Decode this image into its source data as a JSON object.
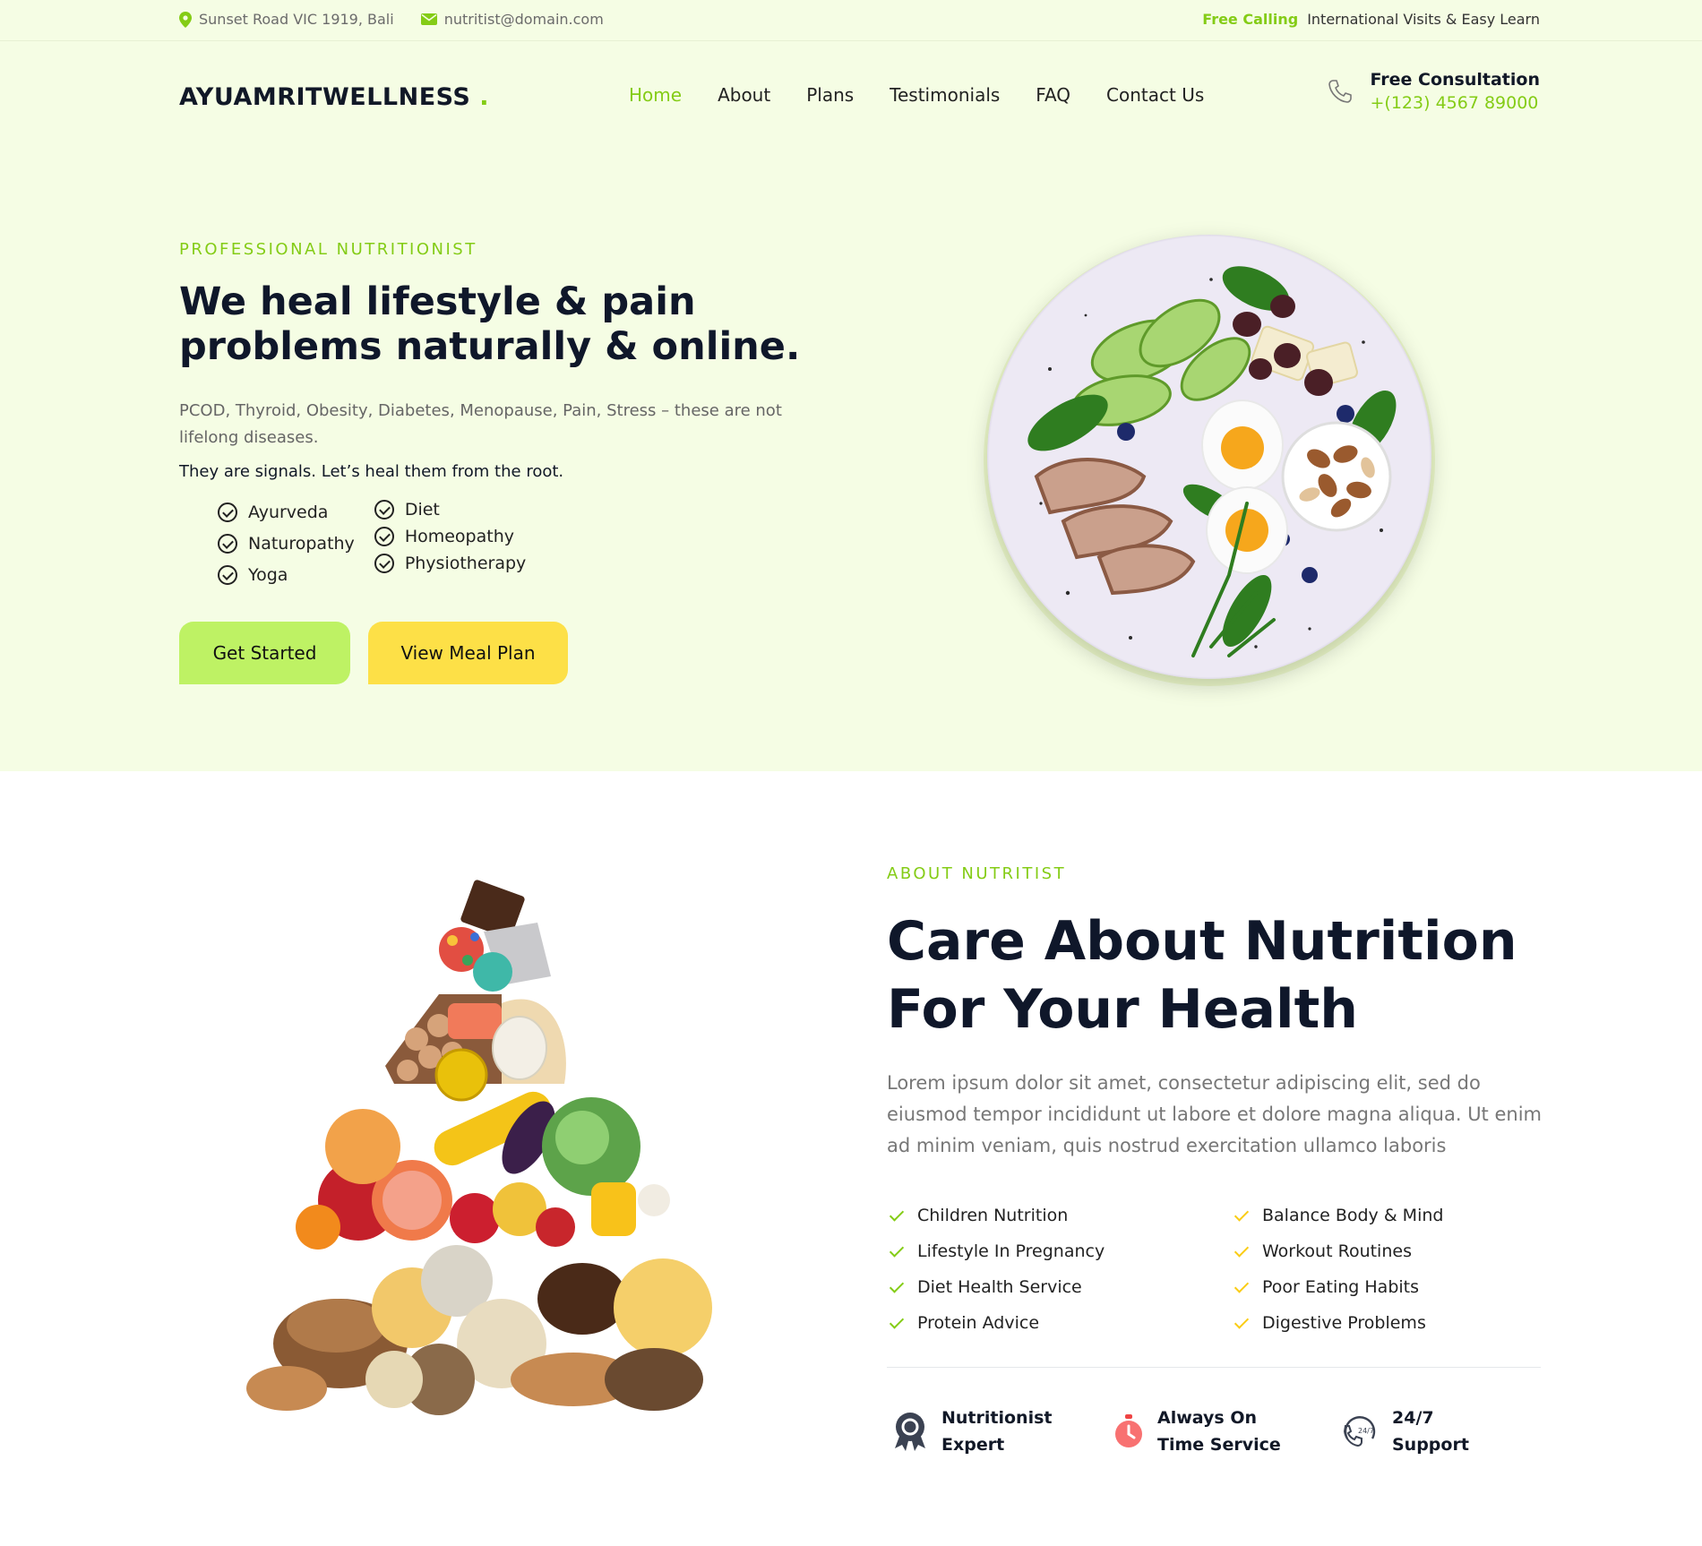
{
  "topbar": {
    "address": "Sunset Road VIC 1919, Bali",
    "email": "nutritist@domain.com",
    "free_calling": "Free Calling",
    "visits": "International Visits & Easy Learn"
  },
  "header": {
    "logo_text": "AYUAMRITWELLNESS",
    "logo_dot": ".",
    "nav": [
      "Home",
      "About",
      "Plans",
      "Testimonials",
      "FAQ",
      "Contact Us"
    ],
    "active_nav": "Home",
    "consult_title": "Free Consultation",
    "consult_phone": "+(123) 4567 89000"
  },
  "hero": {
    "eyebrow": "PROFESSIONAL NUTRITIONIST",
    "title": "We heal lifestyle & pain problems naturally & online.",
    "desc": "PCOD, Thyroid, Obesity, Diabetes, Menopause, Pain, Stress – these are not lifelong diseases.",
    "signal": "They are signals. Let’s heal them from the root.",
    "therapies_col1": [
      "Ayurveda",
      "Naturopathy",
      "Yoga"
    ],
    "therapies_col2": [
      "Diet",
      "Homeopathy",
      "Physiotherapy"
    ],
    "btn_start": "Get Started",
    "btn_meal": "View Meal Plan"
  },
  "about": {
    "eyebrow": "ABOUT NUTRITIST",
    "title": "Care About Nutrition For Your Health",
    "desc": "Lorem ipsum dolor sit amet, consectetur adipiscing elit, sed do eiusmod tempor incididunt ut labore et dolore magna aliqua. Ut enim ad minim veniam, quis nostrud exercitation ullamco laboris",
    "features_left": [
      "Children Nutrition",
      "Lifestyle In Pregnancy",
      "Diet Health Service",
      "Protein Advice"
    ],
    "features_right": [
      "Balance Body & Mind",
      "Workout Routines",
      "Poor Eating Habits",
      "Digestive Problems"
    ],
    "stats": [
      {
        "line1": "Nutritionist",
        "line2": "Expert",
        "icon": "award-icon"
      },
      {
        "line1": "Always On",
        "line2": "Time Service",
        "icon": "stopwatch-icon"
      },
      {
        "line1": "24/7",
        "line2": "Support",
        "icon": "support-24-7-icon"
      }
    ]
  },
  "colors": {
    "accent": "#84cc16",
    "hero_bg": "#f5fde4",
    "btn_green": "#bef264",
    "btn_yellow": "#fde047"
  }
}
